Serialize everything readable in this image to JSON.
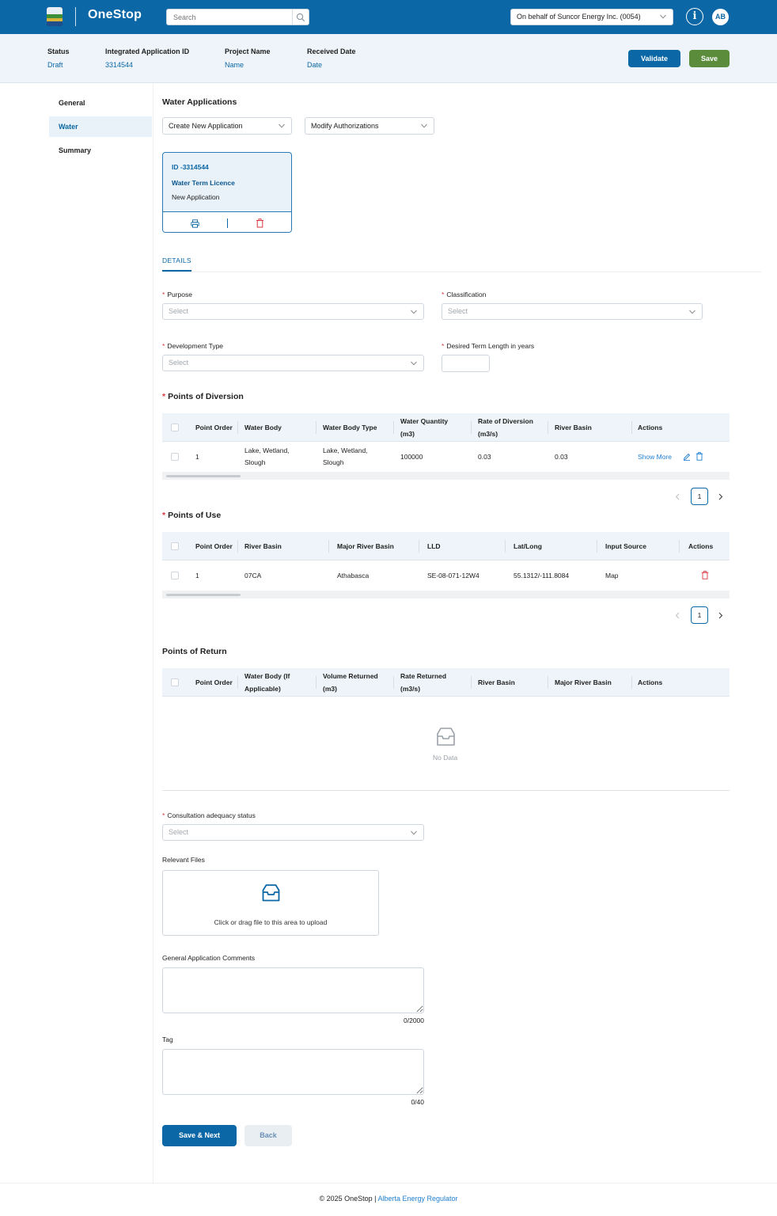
{
  "header": {
    "brand": "OneStop",
    "search_placeholder": "Search",
    "on_behalf": "On behalf of Suncor Energy Inc. (0054)",
    "info_icon_glyph": "i",
    "avatar_initials": "AB",
    "colors": {
      "primary": "#0b67a5",
      "save": "#5a8c3c"
    }
  },
  "summary": {
    "status_label": "Status",
    "status_value": "Draft",
    "app_id_label": "Integrated Application ID",
    "app_id_value": "3314544",
    "project_label": "Project Name",
    "project_value": "Name",
    "received_label": "Received Date",
    "received_value": "Date",
    "validate_label": "Validate",
    "save_label": "Save"
  },
  "sidebar": {
    "items": [
      {
        "label": "General"
      },
      {
        "label": "Water"
      },
      {
        "label": "Summary"
      }
    ]
  },
  "water": {
    "title": "Water Applications",
    "create_dropdown": "Create New Application",
    "modify_dropdown": "Modify Authorizations",
    "card": {
      "id": "ID -3314544",
      "type": "Water Term Licence",
      "subtitle": "New Application"
    },
    "tab": "DETAILS"
  },
  "form": {
    "purpose_label": "Purpose",
    "purpose_value": "Select",
    "classification_label": "Classification",
    "classification_value": "Select",
    "devtype_label": "Development Type",
    "devtype_value": "Select",
    "term_label": "Desired Term Length in years",
    "required_mark": "*"
  },
  "diversion": {
    "title": "Points of Diversion",
    "headers": [
      "Point Order",
      "Water Body",
      "Water Body Type",
      "Water Quantity (m3)",
      "Rate of Diversion (m3/s)",
      "River Basin",
      "Actions"
    ],
    "rows": [
      {
        "order": "1",
        "water_body": "Lake, Wetland, Slough",
        "water_body_type": "Lake, Wetland, Slough",
        "quantity": "100000",
        "rate": "0.03",
        "river_basin": "0.03",
        "action_link": "Show More"
      }
    ],
    "page": "1"
  },
  "use": {
    "title": "Points of Use",
    "headers": [
      "Point Order",
      "River Basin",
      "Major River Basin",
      "LLD",
      "Lat/Long",
      "Input Source",
      "Actions"
    ],
    "rows": [
      {
        "order": "1",
        "river_basin": "07CA",
        "major_river_basin": "Athabasca",
        "lld": "SE-08-071-12W4",
        "latlong": "55.1312/-111.8084",
        "input_source": "Map"
      }
    ],
    "page": "1"
  },
  "return": {
    "title": "Points of Return",
    "headers": [
      "Point Order",
      "Water Body (If Applicable)",
      "Volume Returned (m3)",
      "Rate Returned (m3/s)",
      "River Basin",
      "Major River Basin",
      "Actions"
    ],
    "empty_text": "No Data"
  },
  "consultation": {
    "label": "Consultation adequacy status",
    "value": "Select"
  },
  "files": {
    "label": "Relevant Files",
    "upload_text": "Click or drag file to this area to upload"
  },
  "comments": {
    "label": "General Application Comments",
    "counter": "0/2000"
  },
  "tag": {
    "label": "Tag",
    "counter": "0/40"
  },
  "actions": {
    "next_label": "Save & Next",
    "back_label": "Back"
  },
  "footer": {
    "copyright": "© 2025 OneStop |",
    "org": "Alberta Energy Regulator"
  }
}
